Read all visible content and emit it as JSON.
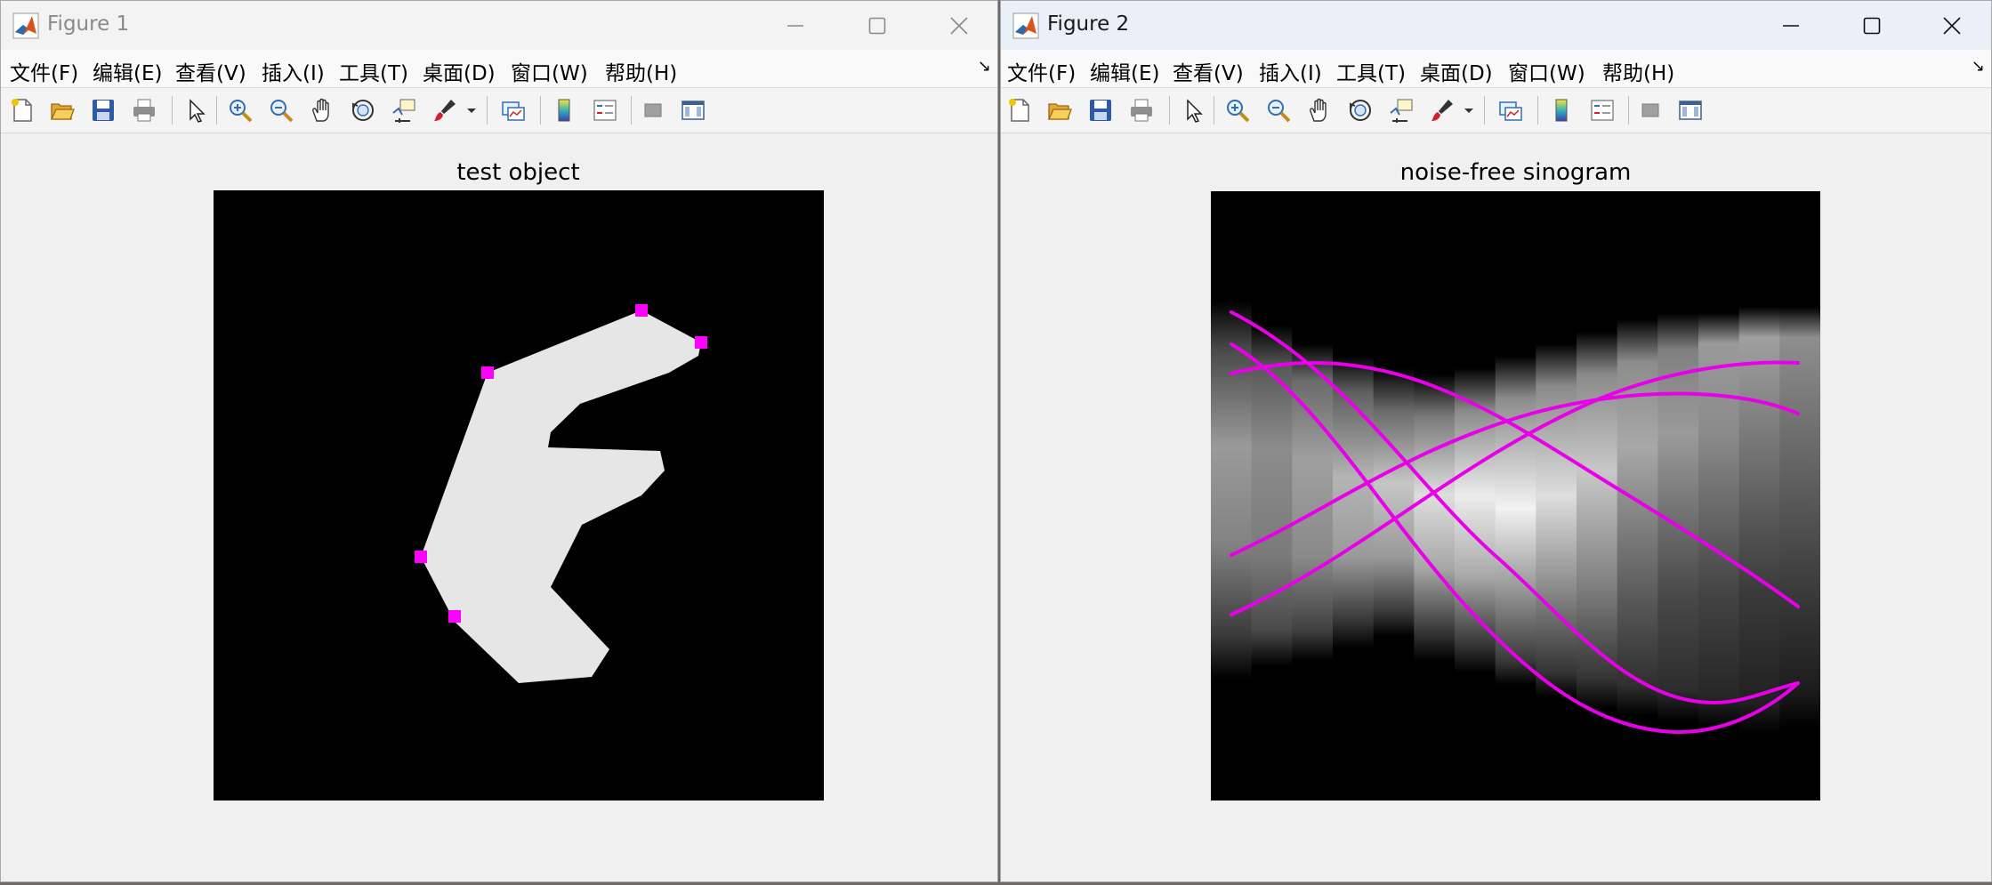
{
  "figure1": {
    "title": "Figure 1",
    "menu": [
      "文件(F)",
      "编辑(E)",
      "查看(V)",
      "插入(I)",
      "工具(T)",
      "桌面(D)",
      "窗口(W)",
      "帮助(H)"
    ],
    "axes_title": "test object"
  },
  "figure2": {
    "title": "Figure 2",
    "menu": [
      "文件(F)",
      "编辑(E)",
      "查看(V)",
      "插入(I)",
      "工具(T)",
      "桌面(D)",
      "窗口(W)",
      "帮助(H)"
    ],
    "axes_title": "noise-free sinogram"
  },
  "menu_more_glyph": "↘",
  "toolbar_icons": [
    "new-figure-icon",
    "open-file-icon",
    "save-icon",
    "print-icon",
    "edit-plot-icon",
    "zoom-in-icon",
    "zoom-out-icon",
    "pan-icon",
    "rotate-3d-icon",
    "data-cursor-icon",
    "brush-icon",
    "brush-dropdown-icon",
    "link-plot-icon",
    "colorbar-icon",
    "legend-icon",
    "hide-plot-tools-icon",
    "show-plot-tools-icon"
  ],
  "colors": {
    "object_fill": "#e6e6e6",
    "marker": "#ff00ff",
    "curve": "#e800e8",
    "axes_background": "#000000"
  },
  "object": {
    "shape": "polygon",
    "marker_count": 5
  },
  "sinogram": {
    "curve_count": 5,
    "column_count": 15
  }
}
